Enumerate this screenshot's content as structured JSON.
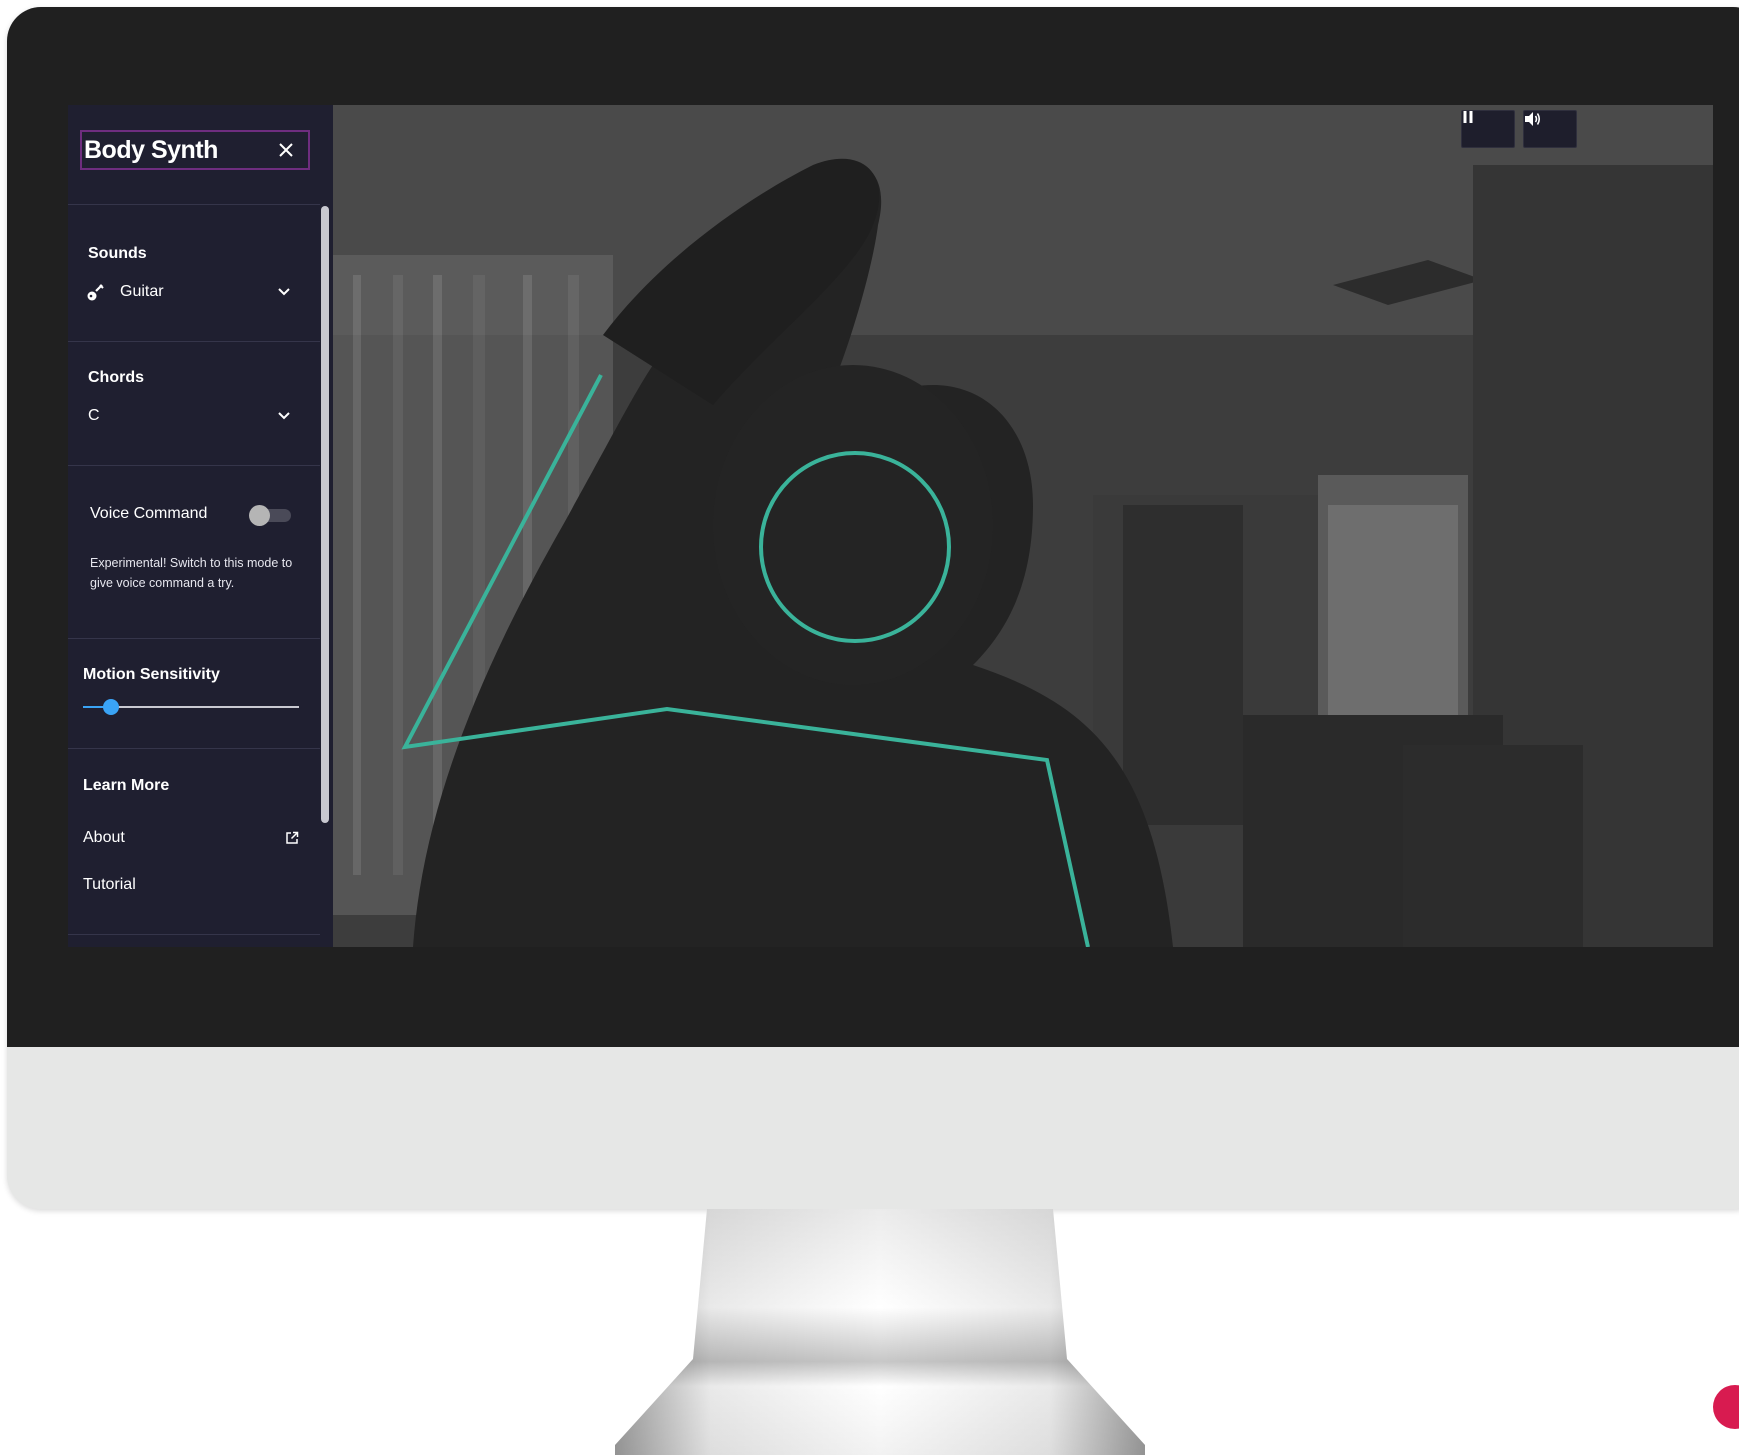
{
  "app": {
    "title": "Body Synth"
  },
  "sidebar": {
    "sounds": {
      "label": "Sounds",
      "selected": "Guitar",
      "icon": "guitar-icon"
    },
    "chords": {
      "label": "Chords",
      "selected": "C"
    },
    "voice": {
      "label": "Voice Command",
      "enabled": false,
      "note": "Experimental! Switch to this mode to give voice command a try."
    },
    "motion": {
      "label": "Motion Sensitivity",
      "value": 0.13
    },
    "learn_more": {
      "label": "Learn More",
      "links": [
        {
          "label": "About",
          "icon": "external-link-icon"
        },
        {
          "label": "Tutorial"
        }
      ]
    }
  },
  "controls": {
    "pause_icon": "pause-icon",
    "volume_icon": "volume-icon"
  },
  "colors": {
    "accent": "#3aa3f5",
    "skeleton": "#3ab39a",
    "title_border": "#6e2d7f",
    "sidebar_bg": "#1f1f30"
  }
}
